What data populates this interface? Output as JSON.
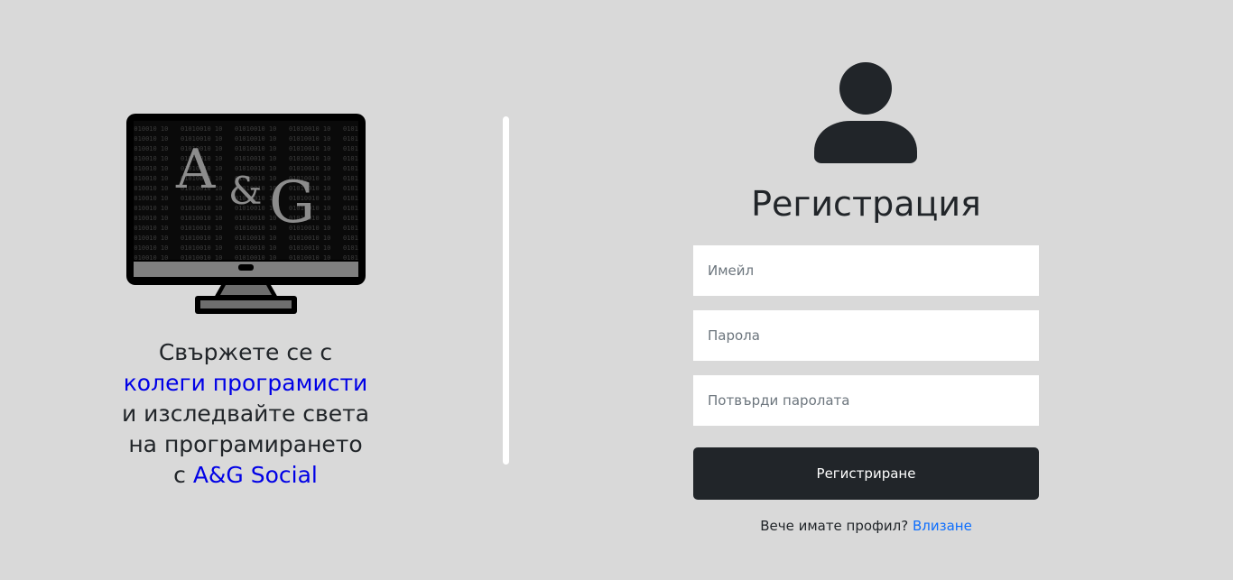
{
  "brand": {
    "logo_text_a": "A",
    "logo_text_amp": "&",
    "logo_text_g": "G"
  },
  "tagline": {
    "line1": "Свържете се с",
    "line2_highlight": "колеги програмисти",
    "line3": "и изследвайте света",
    "line4": "на програмирането",
    "line5_prefix": "с ",
    "line5_highlight": "A&G Social"
  },
  "form": {
    "title": "Регистрация",
    "email_placeholder": "Имейл",
    "password_placeholder": "Парола",
    "confirm_placeholder": "Потвърди паролата",
    "submit_label": "Регистриране",
    "login_prompt": "Вече имате профил?",
    "login_link": "Влизане"
  },
  "colors": {
    "background": "#d9d9d9",
    "highlight": "#0000e6",
    "button": "#212529",
    "link": "#0d6efd"
  }
}
